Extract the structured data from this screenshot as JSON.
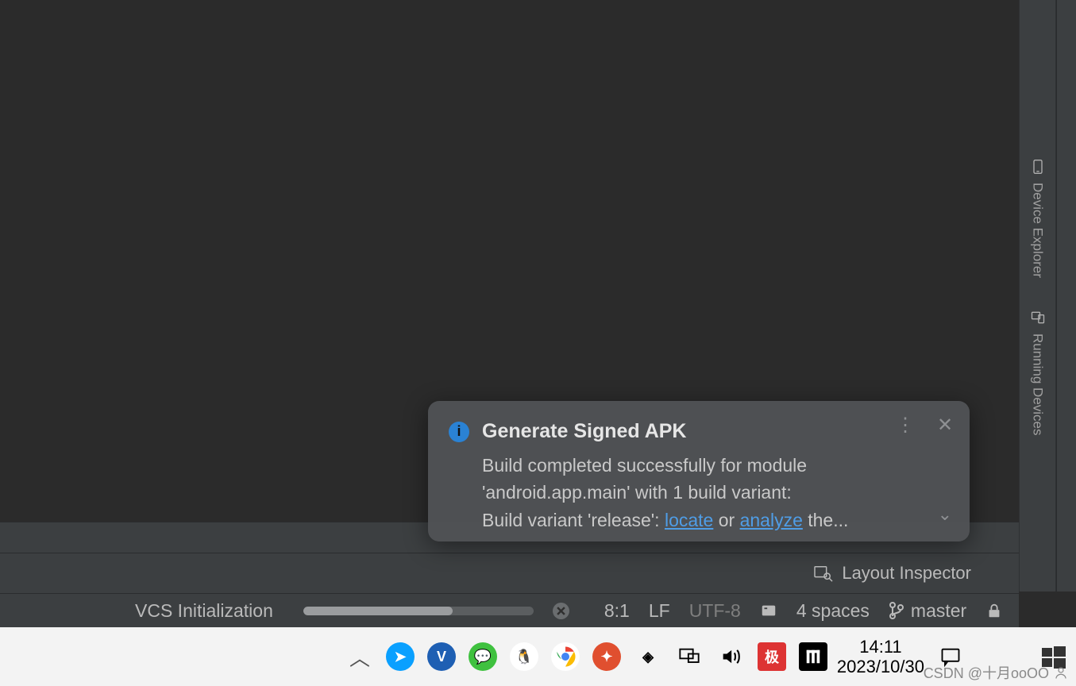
{
  "right_rail": {
    "device_explorer": "Device Explorer",
    "running_devices": "Running Devices"
  },
  "toolwin": {
    "layout_inspector": "Layout Inspector"
  },
  "notification": {
    "title": "Generate Signed APK",
    "line1a": "Build completed successfully for module",
    "line1b": "'android.app.main' with 1 build variant:",
    "line2_prefix": "Build variant 'release': ",
    "locate": "locate",
    "or": " or ",
    "analyze": "analyze",
    "trail": " the..."
  },
  "status": {
    "vcs": "VCS Initialization",
    "pos": "8:1",
    "eol": "LF",
    "enc": "UTF-8",
    "indent": "4 spaces",
    "branch": "master"
  },
  "taskbar": {
    "time": "14:11",
    "date": "2023/10/30"
  },
  "watermark": "CSDN @十月ooOO"
}
